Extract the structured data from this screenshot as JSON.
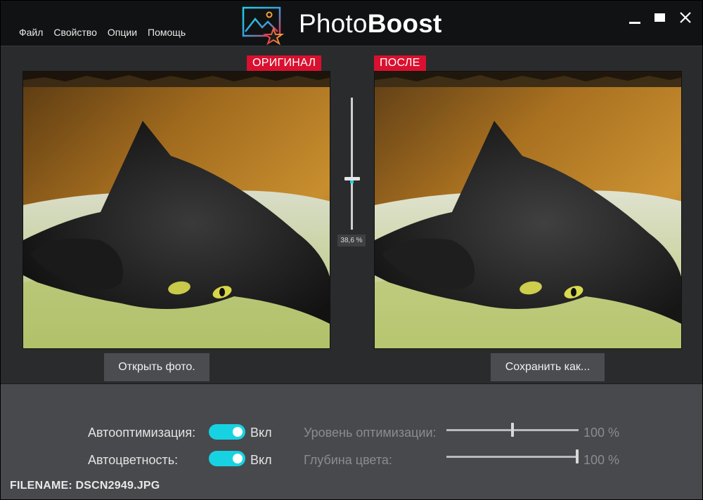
{
  "menu": {
    "items": [
      "Файл",
      "Свойство",
      "Опции",
      "Помощь"
    ]
  },
  "app": {
    "title_regular": "Photo",
    "title_bold": "Boost",
    "logo_icon": "image-star-icon"
  },
  "window_controls": {
    "minimize_icon": "minimize-icon",
    "maximize_icon": "maximize-icon",
    "close_icon": "close-icon"
  },
  "compare": {
    "original_label": "ОРИГИНАЛ",
    "after_label": "ПОСЛЕ",
    "split_percent_text": "38,6 %",
    "split_fraction": 0.386
  },
  "buttons": {
    "open": "Открыть фото.",
    "save": "Сохранить как..."
  },
  "settings": {
    "auto_optimization": {
      "label": "Автооптимизация:",
      "state": "Вкл"
    },
    "auto_color": {
      "label": "Автоцветность:",
      "state": "Вкл"
    },
    "opt_level": {
      "label": "Уровень оптимизации:",
      "value": "100 %",
      "fraction": 0.5
    },
    "color_depth": {
      "label": "Глубина цвета:",
      "value": "100 %",
      "fraction": 1.0
    }
  },
  "status": {
    "filename": "FILENAME: DSCN2949.JPG"
  },
  "colors": {
    "accent": "#17d3e2",
    "tag": "#d9102f",
    "panel": "#47494c",
    "background": "#2a2b2d"
  }
}
